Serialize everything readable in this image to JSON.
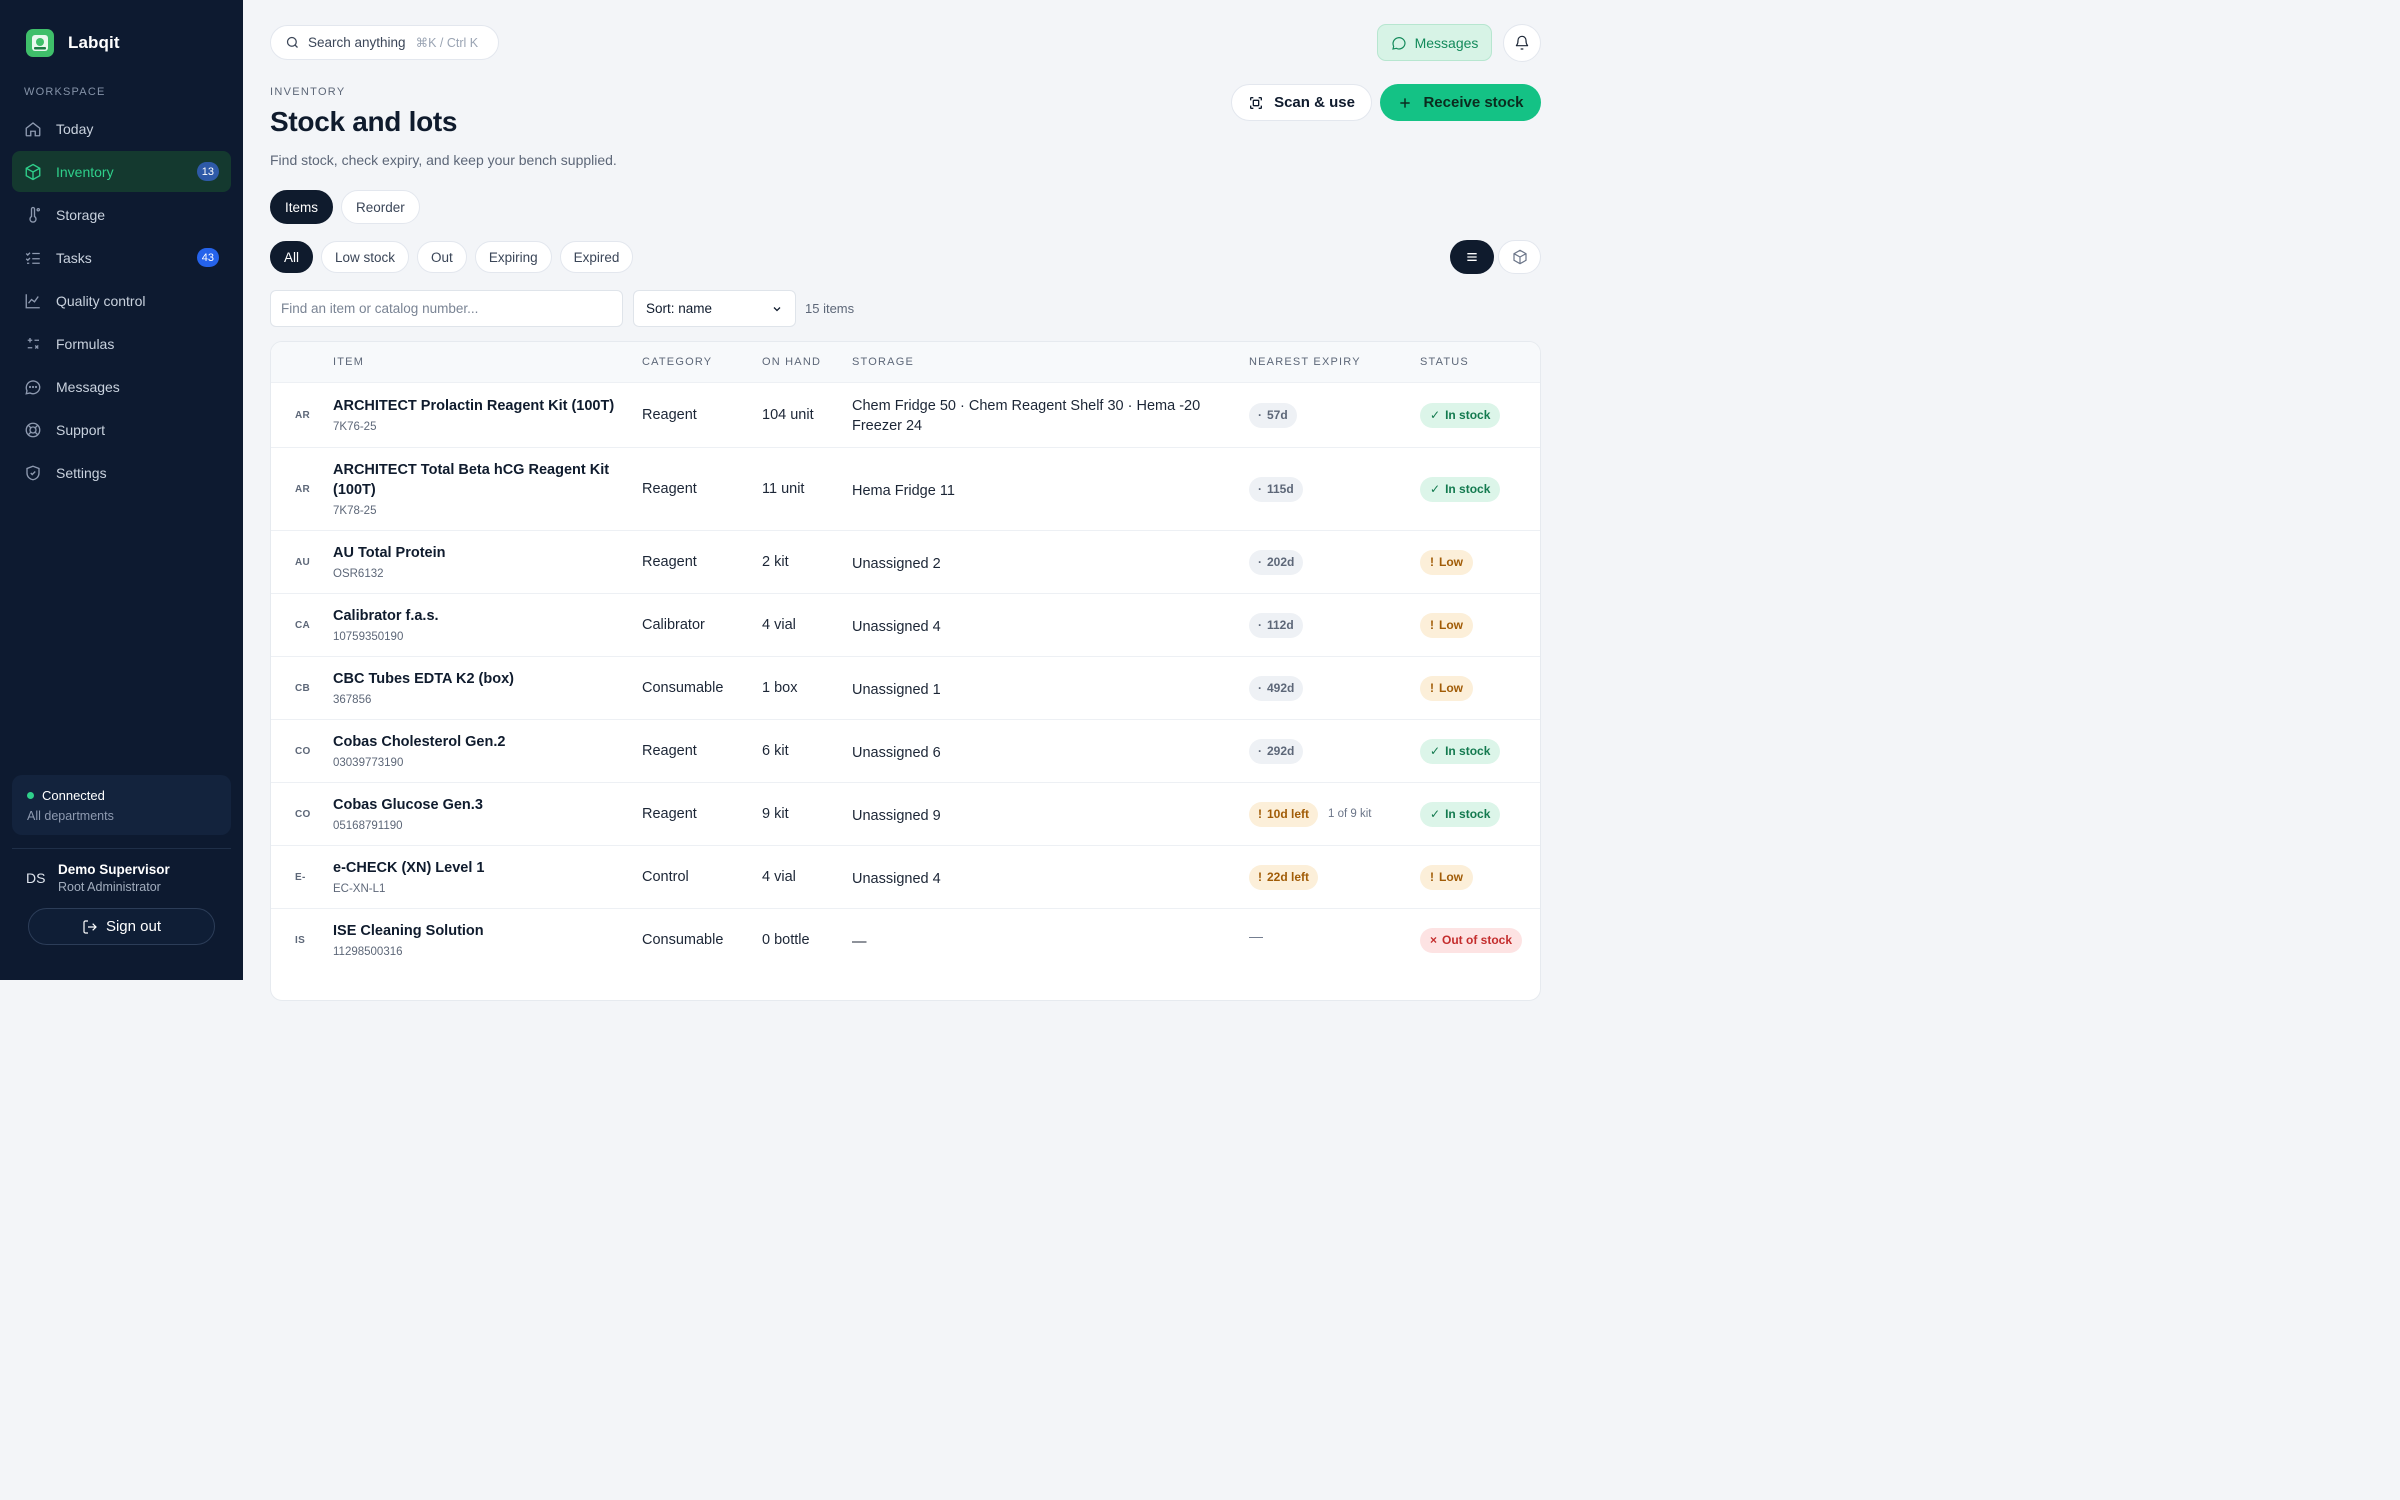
{
  "app": {
    "name": "Labqit"
  },
  "sidebar": {
    "section_label": "WORKSPACE",
    "items": [
      {
        "label": "Today",
        "icon": "home-icon"
      },
      {
        "label": "Inventory",
        "icon": "box-icon",
        "badge": "13",
        "active": true
      },
      {
        "label": "Storage",
        "icon": "thermometer-icon"
      },
      {
        "label": "Tasks",
        "icon": "checklist-icon",
        "badge": "43"
      },
      {
        "label": "Quality control",
        "icon": "chart-icon"
      },
      {
        "label": "Formulas",
        "icon": "calculator-icon"
      },
      {
        "label": "Messages",
        "icon": "chat-icon"
      },
      {
        "label": "Support",
        "icon": "lifebuoy-icon"
      },
      {
        "label": "Settings",
        "icon": "shield-icon"
      }
    ],
    "connection": {
      "status": "Connected",
      "scope": "All departments"
    },
    "user": {
      "initials": "DS",
      "name": "Demo Supervisor",
      "role": "Root Administrator"
    },
    "signout_label": "Sign out"
  },
  "topbar": {
    "search_label": "Search anything",
    "search_shortcut": "⌘K / Ctrl K",
    "messages_label": "Messages"
  },
  "page": {
    "eyebrow": "INVENTORY",
    "title": "Stock and lots",
    "subtitle": "Find stock, check expiry, and keep your bench supplied.",
    "scan_label": "Scan & use",
    "receive_label": "Receive stock",
    "tabs": [
      "Items",
      "Reorder"
    ],
    "filters": [
      "All",
      "Low stock",
      "Out",
      "Expiring",
      "Expired"
    ],
    "find_placeholder": "Find an item or catalog number...",
    "sort_value": "Sort: name",
    "count": "15 items"
  },
  "table": {
    "headers": {
      "item": "ITEM",
      "category": "CATEGORY",
      "on_hand": "ON HAND",
      "storage": "STORAGE",
      "expiry": "NEAREST EXPIRY",
      "status": "STATUS"
    },
    "rows": [
      {
        "abbr": "AR",
        "name": "ARCHITECT Prolactin Reagent Kit (100T)",
        "catalog": "7K76-25",
        "category": "Reagent",
        "on_hand": "104 unit",
        "storage": "Chem Fridge 50 · Chem Reagent Shelf 30 · Hema -20 Freezer 24",
        "expiry": "57d",
        "expiry_kind": "normal",
        "expiry_note": "",
        "status": "In stock",
        "status_kind": "in"
      },
      {
        "abbr": "AR",
        "name": "ARCHITECT Total Beta hCG Reagent Kit (100T)",
        "catalog": "7K78-25",
        "category": "Reagent",
        "on_hand": "11 unit",
        "storage": "Hema Fridge 11",
        "expiry": "115d",
        "expiry_kind": "normal",
        "expiry_note": "",
        "status": "In stock",
        "status_kind": "in"
      },
      {
        "abbr": "AU",
        "name": "AU Total Protein",
        "catalog": "OSR6132",
        "category": "Reagent",
        "on_hand": "2 kit",
        "storage": "Unassigned 2",
        "expiry": "202d",
        "expiry_kind": "normal",
        "expiry_note": "",
        "status": "Low",
        "status_kind": "low"
      },
      {
        "abbr": "CA",
        "name": "Calibrator f.a.s.",
        "catalog": "10759350190",
        "category": "Calibrator",
        "on_hand": "4 vial",
        "storage": "Unassigned 4",
        "expiry": "112d",
        "expiry_kind": "normal",
        "expiry_note": "",
        "status": "Low",
        "status_kind": "low"
      },
      {
        "abbr": "CB",
        "name": "CBC Tubes EDTA K2 (box)",
        "catalog": "367856",
        "category": "Consumable",
        "on_hand": "1 box",
        "storage": "Unassigned 1",
        "expiry": "492d",
        "expiry_kind": "normal",
        "expiry_note": "",
        "status": "Low",
        "status_kind": "low"
      },
      {
        "abbr": "CO",
        "name": "Cobas Cholesterol Gen.2",
        "catalog": "03039773190",
        "category": "Reagent",
        "on_hand": "6 kit",
        "storage": "Unassigned 6",
        "expiry": "292d",
        "expiry_kind": "normal",
        "expiry_note": "",
        "status": "In stock",
        "status_kind": "in"
      },
      {
        "abbr": "CO",
        "name": "Cobas Glucose Gen.3",
        "catalog": "05168791190",
        "category": "Reagent",
        "on_hand": "9 kit",
        "storage": "Unassigned 9",
        "expiry": "10d left",
        "expiry_kind": "warn",
        "expiry_note": "1 of 9 kit",
        "status": "In stock",
        "status_kind": "in"
      },
      {
        "abbr": "E-",
        "name": "e-CHECK (XN) Level 1",
        "catalog": "EC-XN-L1",
        "category": "Control",
        "on_hand": "4 vial",
        "storage": "Unassigned 4",
        "expiry": "22d left",
        "expiry_kind": "warn",
        "expiry_note": "",
        "status": "Low",
        "status_kind": "low"
      },
      {
        "abbr": "IS",
        "name": "ISE Cleaning Solution",
        "catalog": "11298500316",
        "category": "Consumable",
        "on_hand": "0 bottle",
        "storage": "—",
        "expiry": "—",
        "expiry_kind": "none",
        "expiry_note": "",
        "status": "Out of stock",
        "status_kind": "out"
      }
    ]
  }
}
